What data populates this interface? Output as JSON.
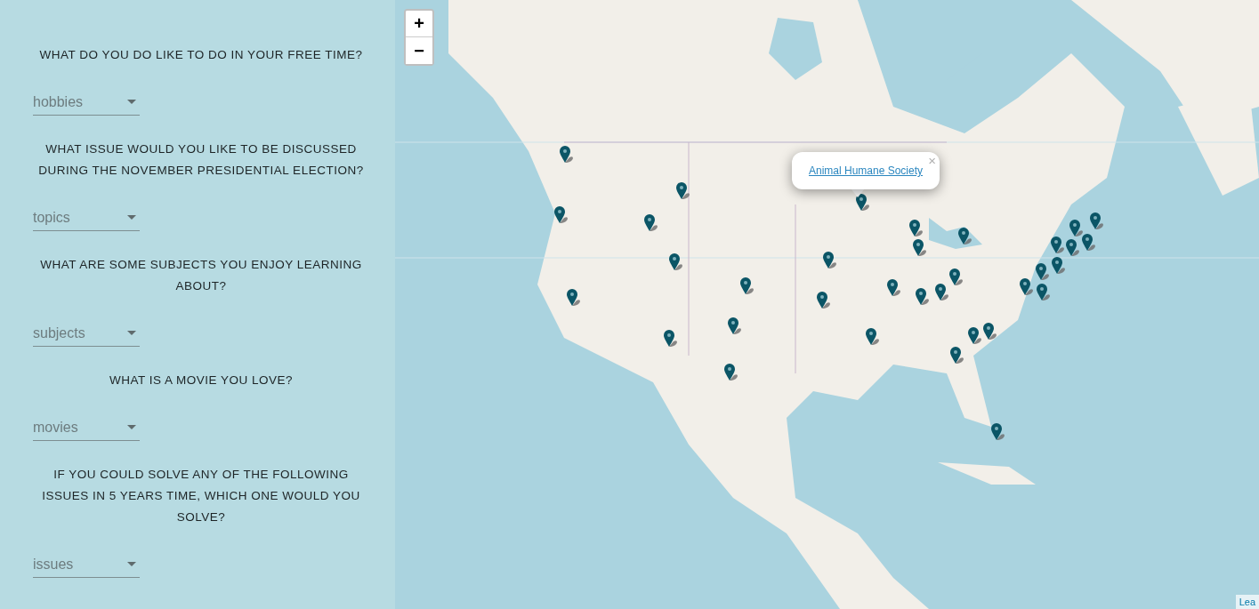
{
  "survey": [
    {
      "question": "WHAT DO YOU DO LIKE TO DO IN YOUR FREE TIME?",
      "placeholder": "hobbies"
    },
    {
      "question": "WHAT ISSUE WOULD YOU LIKE TO BE DISCUSSED DURING THE NOVEMBER PRESIDENTIAL ELECTION?",
      "placeholder": "topics"
    },
    {
      "question": "WHAT ARE SOME SUBJECTS YOU ENJOY LEARNING ABOUT?",
      "placeholder": "subjects"
    },
    {
      "question": "WHAT IS A MOVIE YOU LOVE?",
      "placeholder": "movies"
    },
    {
      "question": "IF YOU COULD SOLVE ANY OF THE FOLLOWING ISSUES IN 5 YEARS TIME, WHICH ONE WOULD YOU SOLVE?",
      "placeholder": "issues"
    }
  ],
  "map": {
    "zoom_in": "+",
    "zoom_out": "−",
    "popup": {
      "link": "Animal Humane Society",
      "close": "×"
    },
    "attribution": "Lea"
  }
}
